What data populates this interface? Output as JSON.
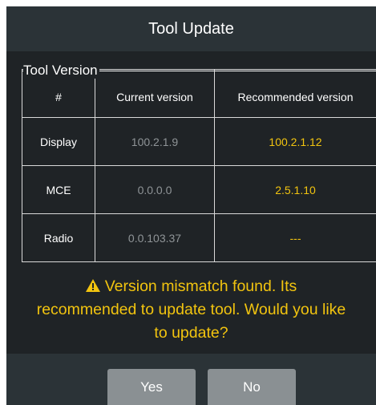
{
  "dialog": {
    "title": "Tool Update"
  },
  "versions": {
    "legend": "Tool Version",
    "headers": [
      "#",
      "Current version",
      "Recommended version"
    ],
    "rows": [
      {
        "name": "Display",
        "current": "100.2.1.9",
        "recommended": "100.2.1.12"
      },
      {
        "name": "MCE",
        "current": "0.0.0.0",
        "recommended": "2.5.1.10"
      },
      {
        "name": "Radio",
        "current": "0.0.103.37",
        "recommended": "---"
      }
    ]
  },
  "message": {
    "icon": "warning-icon",
    "line1": "Version mismatch found. Its",
    "line2": "recommended to update tool. Would you like",
    "line3": "to update?"
  },
  "buttons": {
    "yes": "Yes",
    "no": "No"
  },
  "colors": {
    "background": "#1f2326",
    "header": "#2b3337",
    "accent": "#f2c40f",
    "muted": "#8f9497",
    "button": "#8a9093"
  }
}
